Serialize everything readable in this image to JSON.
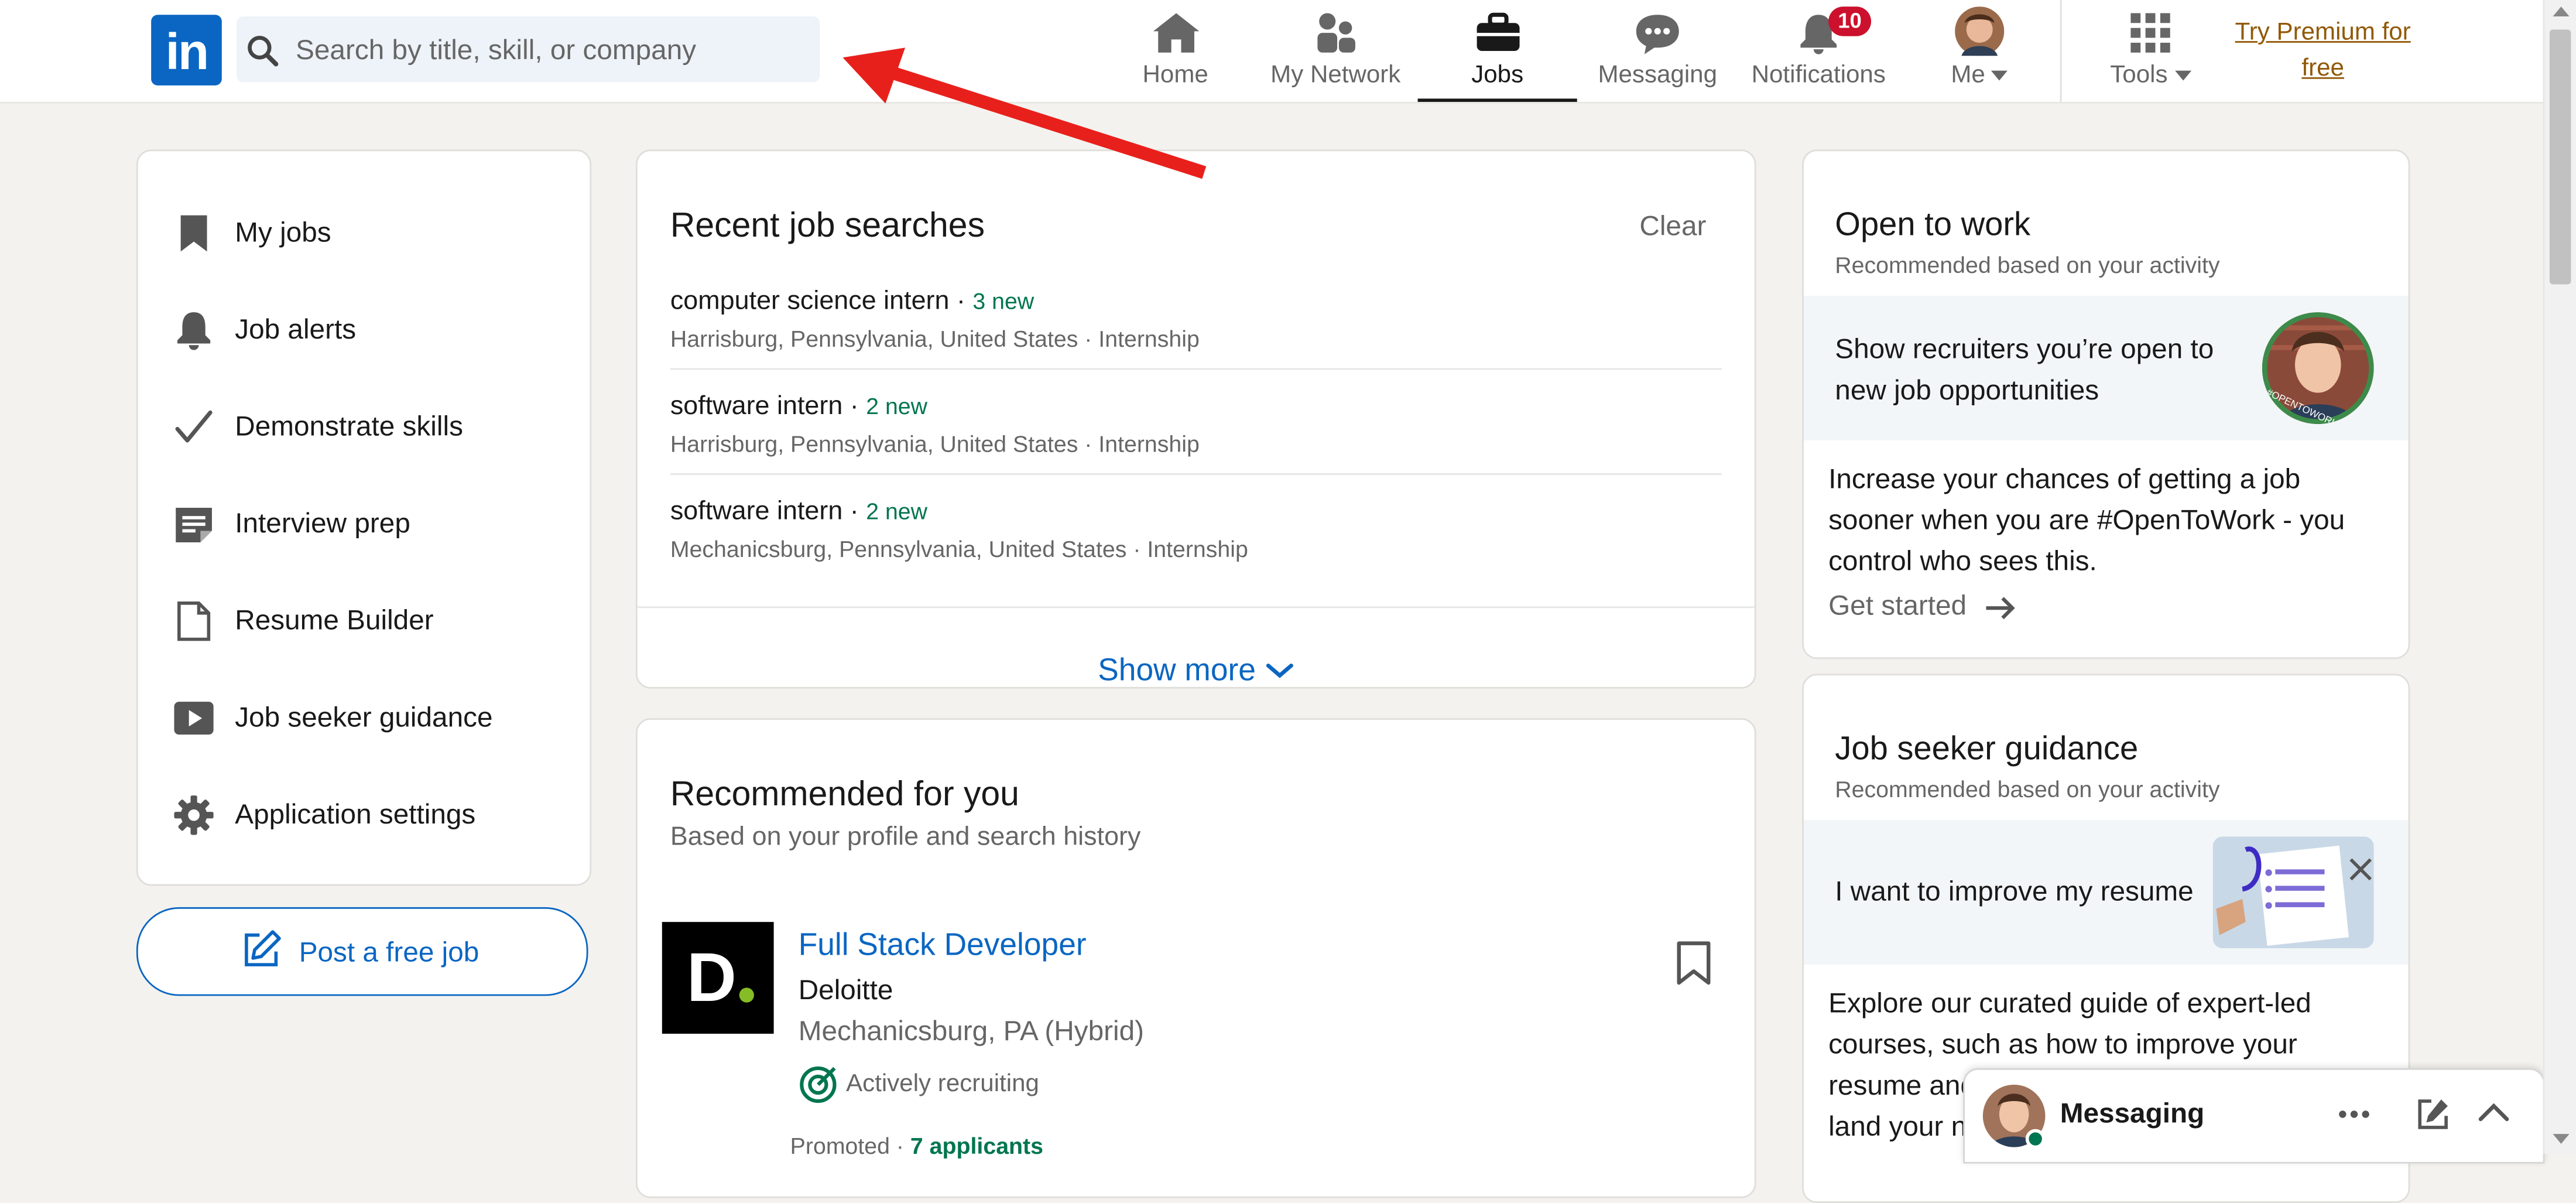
{
  "header": {
    "logo_text": "in",
    "search_placeholder": "Search by title, skill, or company",
    "nav": [
      {
        "label": "Home",
        "icon": "home-icon"
      },
      {
        "label": "My Network",
        "icon": "people-icon"
      },
      {
        "label": "Jobs",
        "icon": "briefcase-icon",
        "active": true
      },
      {
        "label": "Messaging",
        "icon": "chat-bubble-icon"
      },
      {
        "label": "Notifications",
        "icon": "bell-icon",
        "badge": "10"
      },
      {
        "label": "Me",
        "icon": "avatar"
      },
      {
        "label": "Tools",
        "icon": "grid-icon"
      }
    ],
    "premium_line1": "Try Premium for",
    "premium_line2": "free"
  },
  "sidebar": {
    "items": [
      {
        "label": "My jobs",
        "icon": "bookmark-icon"
      },
      {
        "label": "Job alerts",
        "icon": "bell-icon"
      },
      {
        "label": "Demonstrate skills",
        "icon": "checkmark-icon"
      },
      {
        "label": "Interview prep",
        "icon": "notes-icon"
      },
      {
        "label": "Resume Builder",
        "icon": "document-icon"
      },
      {
        "label": "Job seeker guidance",
        "icon": "play-icon"
      },
      {
        "label": "Application settings",
        "icon": "gear-icon"
      }
    ],
    "post_job_label": "Post a free job"
  },
  "recent_searches": {
    "title": "Recent job searches",
    "clear_label": "Clear",
    "items": [
      {
        "query": "computer science intern",
        "new_count": "3 new",
        "location": "Harrisburg, Pennsylvania, United States · Internship"
      },
      {
        "query": "software intern",
        "new_count": "2 new",
        "location": "Harrisburg, Pennsylvania, United States · Internship"
      },
      {
        "query": "software intern",
        "new_count": "2 new",
        "location": "Mechanicsburg, Pennsylvania, United States · Internship"
      }
    ],
    "show_more_label": "Show more"
  },
  "recommended": {
    "title": "Recommended for you",
    "subtitle": "Based on your profile and search history",
    "job": {
      "title": "Full Stack Developer",
      "company": "Deloitte",
      "location": "Mechanicsburg, PA (Hybrid)",
      "status": "Actively recruiting",
      "promoted": "Promoted · ",
      "applicants": "7 applicants"
    }
  },
  "open_to_work": {
    "title": "Open to work",
    "subtitle": "Recommended based on your activity",
    "banner": "Show recruiters you’re open to new job opportunities",
    "frame_text": "#OPENTOWORK",
    "body": "Increase your chances of getting a job sooner when you are #OpenToWork - you control who sees this.",
    "cta": "Get started"
  },
  "guidance": {
    "title": "Job seeker guidance",
    "subtitle": "Recommended based on your activity",
    "banner": "I want to improve my resume",
    "body": "Explore our curated guide of expert-led courses, such as how to improve your resume and grow your network, to help you land your next opportunity."
  },
  "messaging": {
    "label": "Messaging"
  },
  "colors": {
    "brand": "#0a66c2",
    "badge": "#cb112d",
    "new_green": "#01754f",
    "premium_gold": "#915907",
    "arrow_red": "#e8201c"
  }
}
